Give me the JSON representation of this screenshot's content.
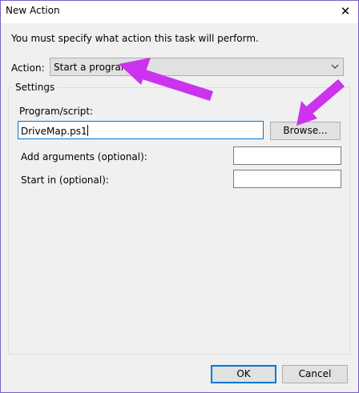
{
  "window": {
    "title": "New Action",
    "close_glyph": "✕"
  },
  "instruction": "You must specify what action this task will perform.",
  "action": {
    "label": "Action:",
    "selected_value": "Start a program"
  },
  "settings": {
    "group_label": "Settings",
    "program_label": "Program/script:",
    "program_value": "DriveMap.ps1",
    "browse_label": "Browse...",
    "arguments_label": "Add arguments (optional):",
    "arguments_value": "",
    "start_in_label": "Start in (optional):",
    "start_in_value": ""
  },
  "buttons": {
    "ok_label": "OK",
    "cancel_label": "Cancel"
  },
  "colors": {
    "annotation_arrow": "#cc33ee",
    "focus_border": "#0078d7",
    "window_border": "#7a5ec8",
    "dialog_background": "#f0f0f0"
  },
  "icons": {
    "close": "close-icon",
    "dropdown": "chevron-down-icon"
  }
}
